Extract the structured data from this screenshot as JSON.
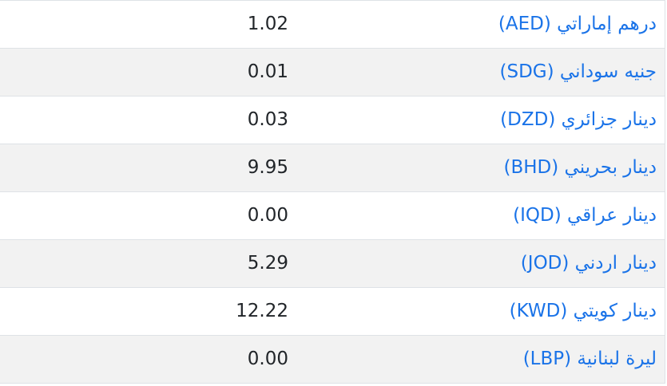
{
  "colors": {
    "link": "#1a73e8",
    "text": "#212529",
    "stripe": "#f2f2f2",
    "border": "#dee2e6"
  },
  "rates": [
    {
      "currency": "درهم إماراتي (AED)",
      "value": "1.02"
    },
    {
      "currency": "جنيه سوداني (SDG)",
      "value": "0.01"
    },
    {
      "currency": "دينار جزائري (DZD)",
      "value": "0.03"
    },
    {
      "currency": "دينار بحريني (BHD)",
      "value": "9.95"
    },
    {
      "currency": "دينار عراقي (IQD)",
      "value": "0.00"
    },
    {
      "currency": "دينار اردني (JOD)",
      "value": "5.29"
    },
    {
      "currency": "دينار كويتي (KWD)",
      "value": "12.22"
    },
    {
      "currency": "ليرة لبنانية (LBP)",
      "value": "0.00"
    }
  ]
}
